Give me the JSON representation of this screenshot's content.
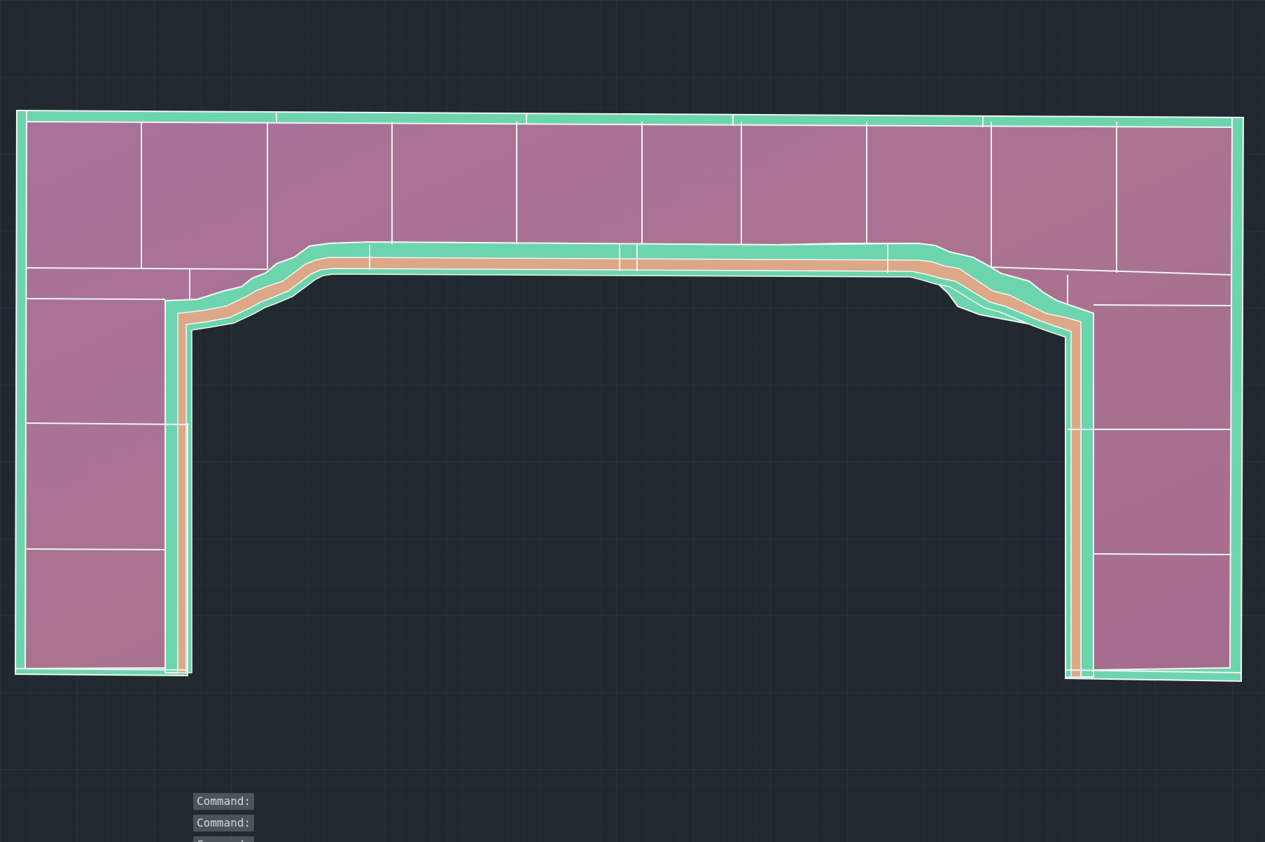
{
  "colors": {
    "background": "#212830",
    "grid_minor": "#283039",
    "grid_major": "#2e3742",
    "tile_fill": "#a66c8e",
    "border_band": "#6dd5ad",
    "accent_band": "#dca888",
    "outline": "#f2f4f4"
  },
  "command_history": [
    {
      "text": "Command:"
    },
    {
      "text": "Command:"
    },
    {
      "text": "Command:"
    }
  ]
}
